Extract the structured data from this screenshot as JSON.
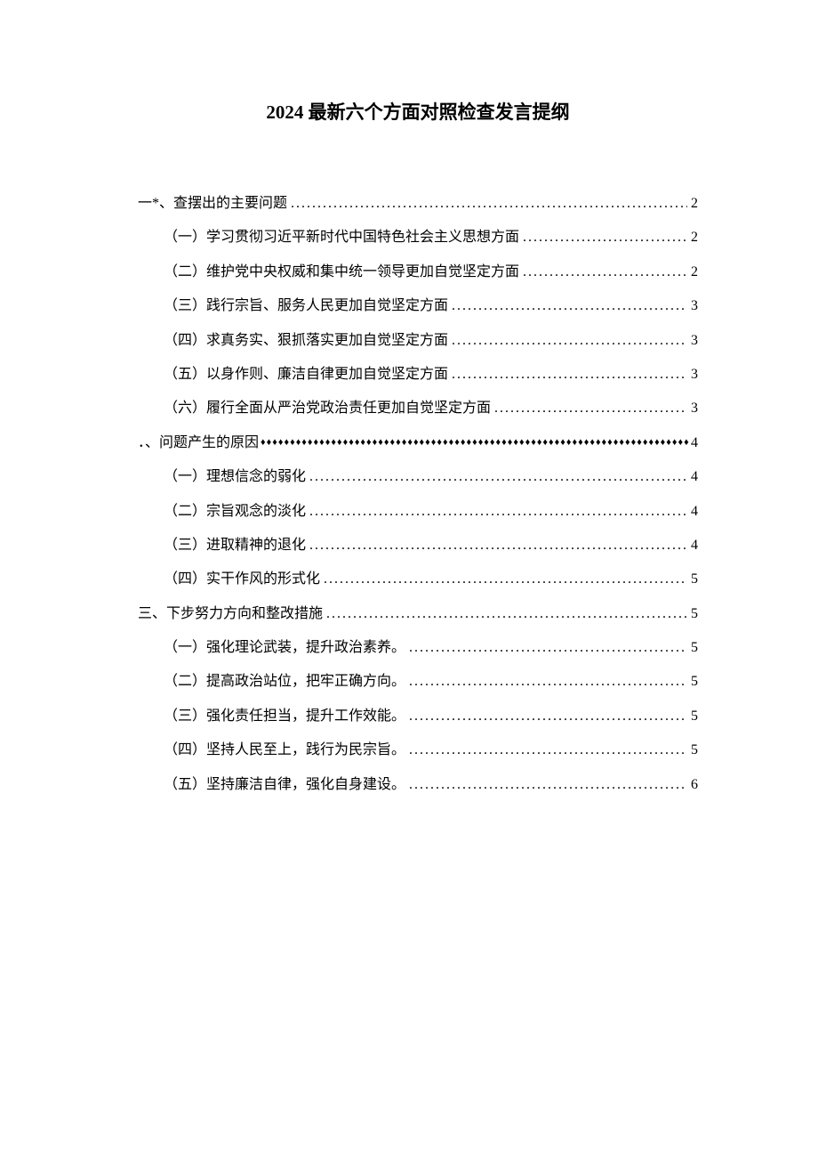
{
  "title": "2024 最新六个方面对照检查发言提纲",
  "toc": {
    "s1": {
      "label": "一*、查摆出的主要问题",
      "page": "2",
      "items": {
        "i1": {
          "label": "（一）学习贯彻习近平新时代中国特色社会主义思想方面",
          "page": "2"
        },
        "i2": {
          "label": "（二）维护党中央权威和集中统一领导更加自觉坚定方面",
          "page": "2"
        },
        "i3": {
          "label": "（三）践行宗旨、服务人民更加自觉坚定方面",
          "page": "3"
        },
        "i4": {
          "label": "（四）求真务实、狠抓落实更加自觉坚定方面",
          "page": "3"
        },
        "i5": {
          "label": "（五）以身作则、廉洁自律更加自觉坚定方面",
          "page": "3"
        },
        "i6": {
          "label": "（六）履行全面从严治党政治责任更加自觉坚定方面",
          "page": "3"
        }
      }
    },
    "s2": {
      "label": "．、问题产生的原因",
      "page": "4",
      "items": {
        "i1": {
          "label": "（一）理想信念的弱化",
          "page": "4"
        },
        "i2": {
          "label": "（二）宗旨观念的淡化",
          "page": "4"
        },
        "i3": {
          "label": "（三）进取精神的退化",
          "page": "4"
        },
        "i4": {
          "label": "（四）实干作风的形式化",
          "page": "5"
        }
      }
    },
    "s3": {
      "label": "三、下步努力方向和整改措施",
      "page": "5",
      "items": {
        "i1": {
          "label": "（一）强化理论武装，提升政治素养。",
          "page": "5"
        },
        "i2": {
          "label": "（二）提高政治站位，把牢正确方向。",
          "page": "5"
        },
        "i3": {
          "label": "（三）强化责任担当，提升工作效能。",
          "page": "5"
        },
        "i4": {
          "label": "（四）坚持人民至上，践行为民宗旨。",
          "page": "5"
        },
        "i5": {
          "label": "（五）坚持廉洁自律，强化自身建设。",
          "page": "6"
        }
      }
    }
  },
  "leaders": {
    "dots": "..................................................................................",
    "diamonds": "♦♦♦♦♦♦♦♦♦♦♦♦♦♦♦♦♦♦♦♦♦♦♦♦♦♦♦♦♦♦♦♦♦♦♦♦♦♦♦♦♦♦♦♦♦♦♦♦♦♦♦♦♦♦♦♦♦♦♦♦♦♦♦♦♦♦♦♦♦♦♦♦♦♦♦♦♦♦♦♦♦♦♦♦"
  }
}
